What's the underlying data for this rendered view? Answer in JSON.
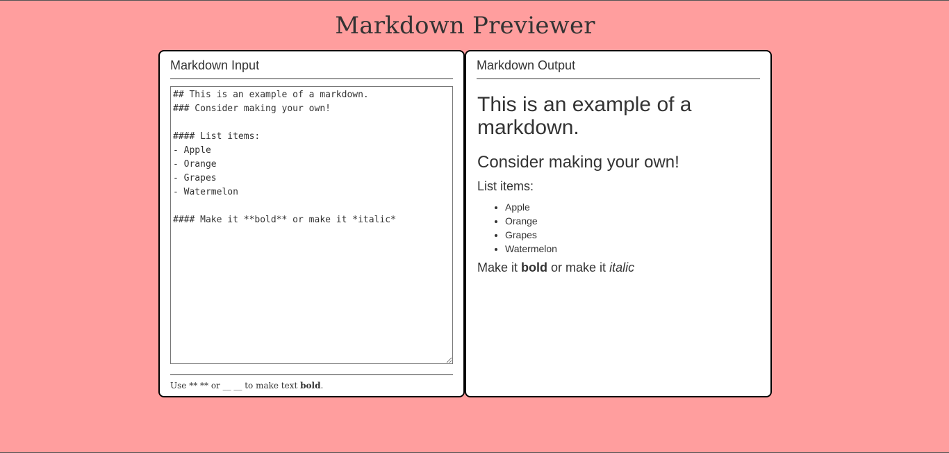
{
  "app": {
    "title": "Markdown Previewer"
  },
  "input_panel": {
    "heading": "Markdown Input",
    "editor_value": "## This is an example of a markdown.\n### Consider making your own!\n\n#### List items:\n- Apple\n- Orange\n- Grapes\n- Watermelon\n\n#### Make it **bold** or make it *italic*",
    "hint": {
      "prefix": "Use ** ** or __ __ to make text ",
      "bold_word": "bold",
      "suffix": "."
    }
  },
  "output_panel": {
    "heading": "Markdown Output",
    "h2": "This is an example of a markdown.",
    "h3": "Consider making your own!",
    "h4_list": "List items:",
    "list_items": [
      "Apple",
      "Orange",
      "Grapes",
      "Watermelon"
    ],
    "last_line": {
      "prefix": "Make it ",
      "bold": "bold",
      "middle": " or make it ",
      "italic": "italic"
    }
  },
  "colors": {
    "background": "#ff9e9e",
    "panel": "#ffffff",
    "text": "#333333",
    "border": "#000000"
  }
}
